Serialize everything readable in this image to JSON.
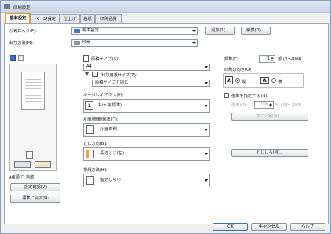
{
  "window": {
    "title": "印刷設定"
  },
  "tabs": [
    {
      "label": "基本設定"
    },
    {
      "label": "ページ設定"
    },
    {
      "label": "仕上げ"
    },
    {
      "label": "給紙"
    },
    {
      "label": "印刷品質"
    }
  ],
  "favorites": {
    "label": "お気に入り(F):",
    "value": "標準設定",
    "add_btn": "追加(1)...",
    "edit_btn": "編集(2)..."
  },
  "output": {
    "label": "出力方法(M):",
    "value": "印刷"
  },
  "preview": {
    "caption": "A4(原寸 自動)",
    "settings_btn": "設定確認(V)",
    "restore_btn": "標準に戻す(R)"
  },
  "paper_size": {
    "label": "原稿サイズ(S):",
    "value": "A4"
  },
  "output_size": {
    "label": "出力用紙サイズ(Z):",
    "value": "原稿サイズと同じ"
  },
  "copies": {
    "label": "部数(C):",
    "value": "1",
    "unit": "部 (1〜999)"
  },
  "orientation": {
    "label": "印刷の向き(O)",
    "portrait": "縦",
    "landscape": "横",
    "letter_a": "A"
  },
  "layout": {
    "label": "ページレイアウト(Y):",
    "value": "1 in 1(標準)",
    "icon_text": "1"
  },
  "scale": {
    "check_label": "倍率を指定する(N)",
    "label": "倍率(O):",
    "value": "100",
    "unit": "% (25〜200)"
  },
  "watermark_btn": "加工印刷(X)...",
  "duplex": {
    "label": "片面/両面/製本(T):",
    "value": "片面印刷"
  },
  "binding": {
    "label": "とじ方向(B):",
    "value": "長辺とじ(左)",
    "margin_btn": "とじしろ(M)..."
  },
  "staple": {
    "label": "排紙方法(H):",
    "value": "指定しない"
  },
  "footer": {
    "ok": "OK",
    "cancel": "キャンセル",
    "help": "ヘルプ"
  }
}
